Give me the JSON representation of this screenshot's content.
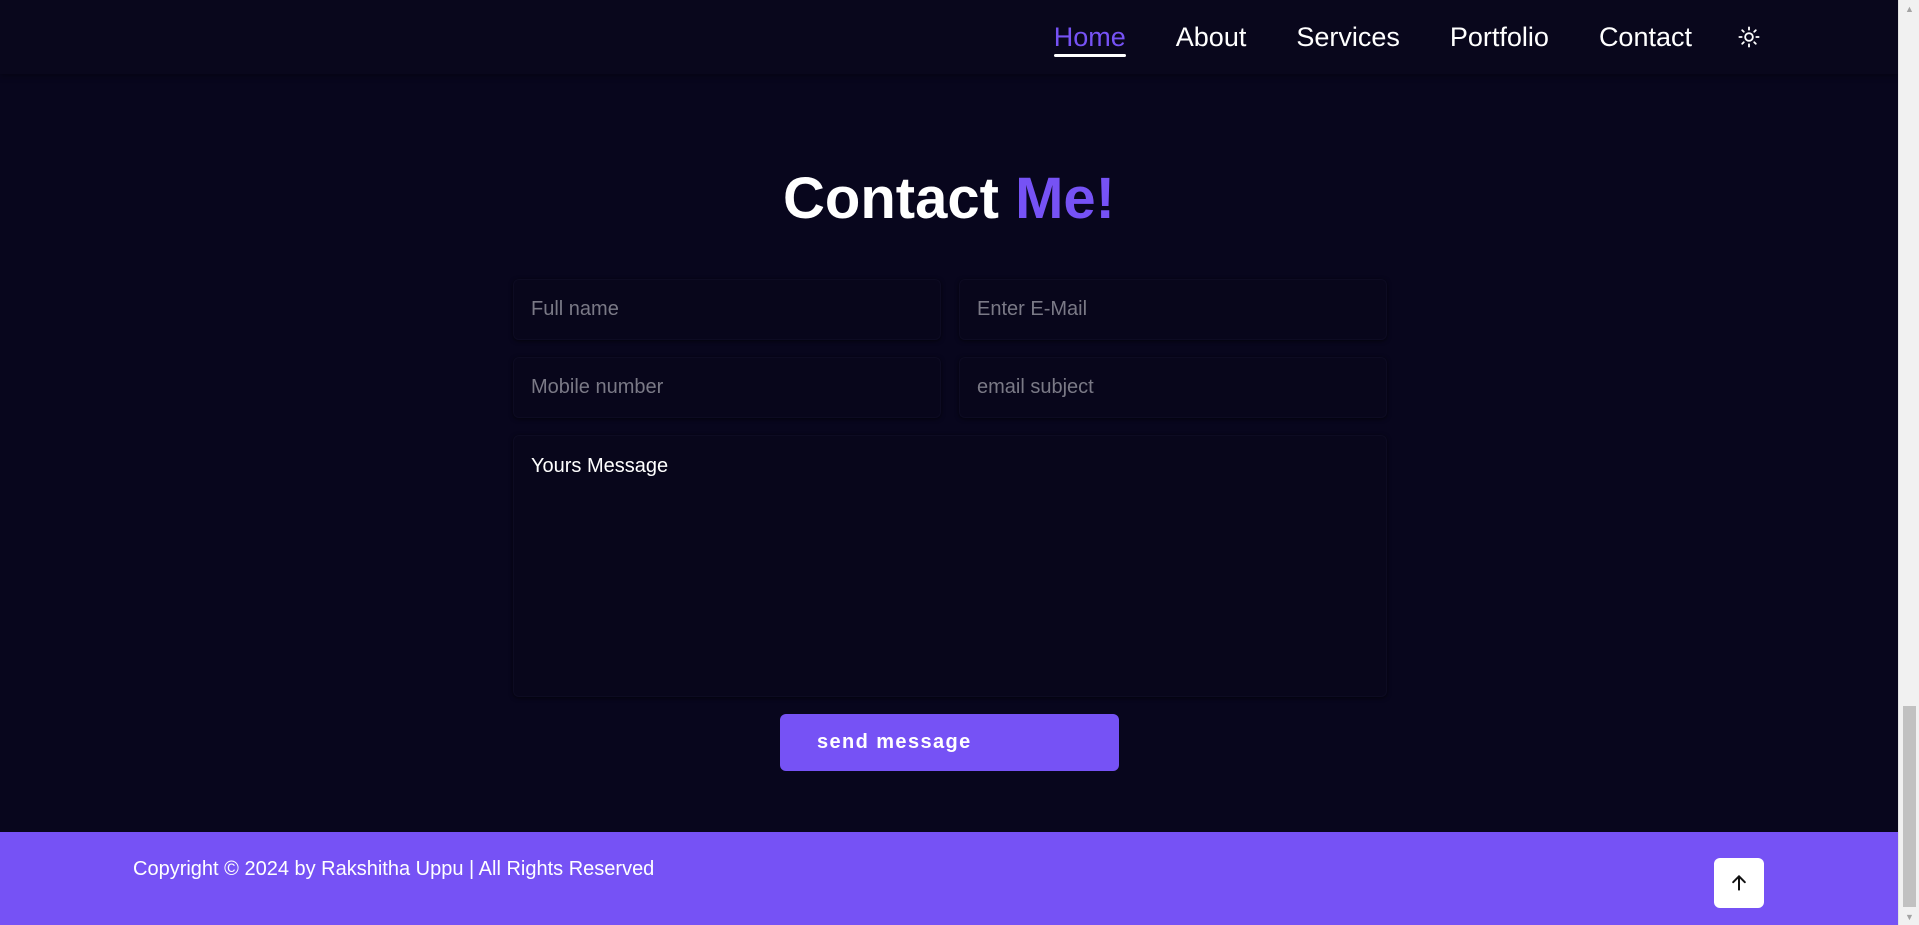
{
  "nav": {
    "items": [
      {
        "label": "Home",
        "active": true
      },
      {
        "label": "About",
        "active": false
      },
      {
        "label": "Services",
        "active": false
      },
      {
        "label": "Portfolio",
        "active": false
      },
      {
        "label": "Contact",
        "active": false
      }
    ],
    "theme_icon": "sun-icon"
  },
  "contact": {
    "title_main": "Contact",
    "title_accent": "Me!",
    "fields": {
      "full_name_placeholder": "Full name",
      "email_placeholder": "Enter E-Mail",
      "mobile_placeholder": "Mobile number",
      "subject_placeholder": "email subject",
      "message_placeholder": "Yours Message"
    },
    "send_label": "send message"
  },
  "footer": {
    "copyright": "Copyright © 2024 by Rakshitha Uppu | All Rights Reserved",
    "top_icon": "arrow-up-icon"
  },
  "colors": {
    "background": "#08061d",
    "accent": "#7652f5",
    "text": "#ffffff"
  }
}
